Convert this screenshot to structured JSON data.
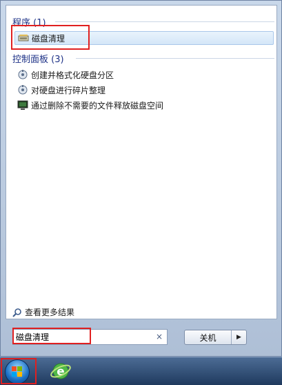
{
  "programs_header": "程序 (1)",
  "programs": [
    {
      "label": "磁盘清理",
      "icon": "disk-cleanup-icon"
    }
  ],
  "control_panel_header": "控制面板 (3)",
  "control_panel": [
    {
      "label": "创建并格式化硬盘分区",
      "icon": "admin-tools-icon"
    },
    {
      "label": "对硬盘进行碎片整理",
      "icon": "admin-tools-icon"
    },
    {
      "label": "通过删除不需要的文件释放磁盘空间",
      "icon": "system-icon"
    }
  ],
  "see_more": "查看更多结果",
  "search": {
    "value": "磁盘清理",
    "clear": "×"
  },
  "shutdown": {
    "label": "关机",
    "arrow": "▶"
  },
  "colors": {
    "header": "#1e3287",
    "highlight": "#e02020",
    "selection": "#d4e6f8"
  }
}
